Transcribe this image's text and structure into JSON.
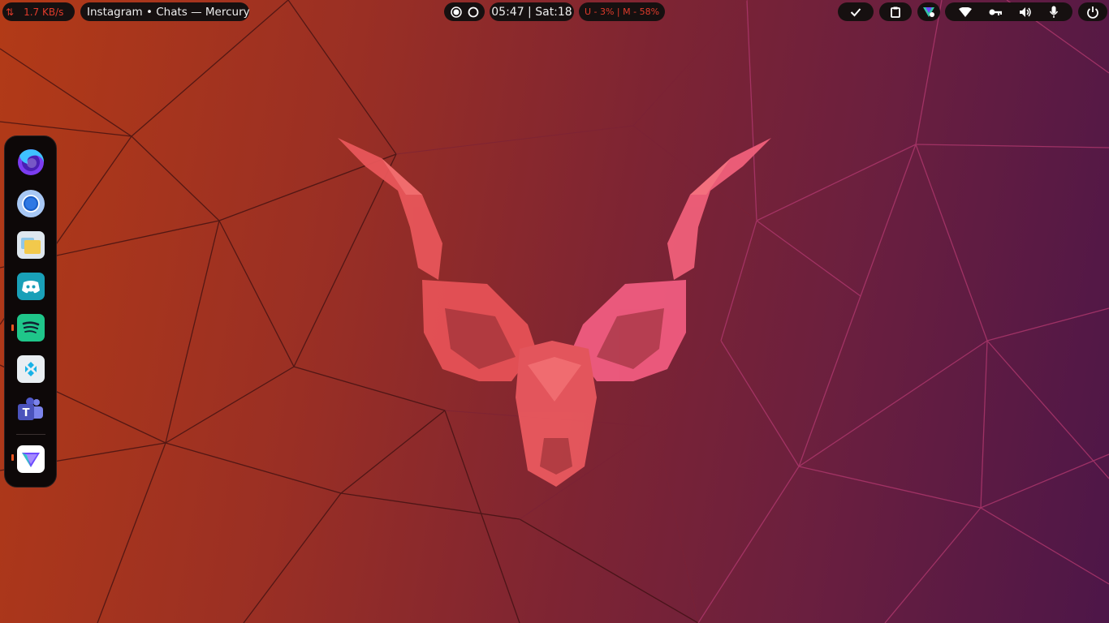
{
  "topbar": {
    "net_arrow": "⇅",
    "net_speed": "1.7 KB/s",
    "window_title": "Instagram • Chats — Mercury",
    "clock": "05:47 | Sat:18",
    "usage": "U - 3% | M - 58%",
    "status_icons": [
      "record-icon",
      "circle-icon",
      "check-icon",
      "clipboard-icon",
      "vpn-icon",
      "wifi-icon",
      "key-icon",
      "volume-icon",
      "microphone-icon",
      "power-icon"
    ]
  },
  "dock": {
    "apps": [
      {
        "name": "Firefox",
        "icon": "firefox-icon",
        "running": false
      },
      {
        "name": "Chromium",
        "icon": "chromium-icon",
        "running": false
      },
      {
        "name": "Files",
        "icon": "files-icon",
        "running": false
      },
      {
        "name": "Discord",
        "icon": "discord-icon",
        "running": false
      },
      {
        "name": "Spotify",
        "icon": "spotify-icon",
        "running": true
      },
      {
        "name": "Kodi",
        "icon": "kodi-icon",
        "running": false
      },
      {
        "name": "Microsoft Teams",
        "icon": "teams-icon",
        "running": false
      },
      {
        "name": "ProtonVPN",
        "icon": "protonvpn-icon",
        "running": true
      }
    ]
  },
  "colors": {
    "accent": "#e03b2b",
    "panel": "#161010",
    "wallpaper_left": "#b23a17",
    "wallpaper_right": "#4d1648"
  }
}
